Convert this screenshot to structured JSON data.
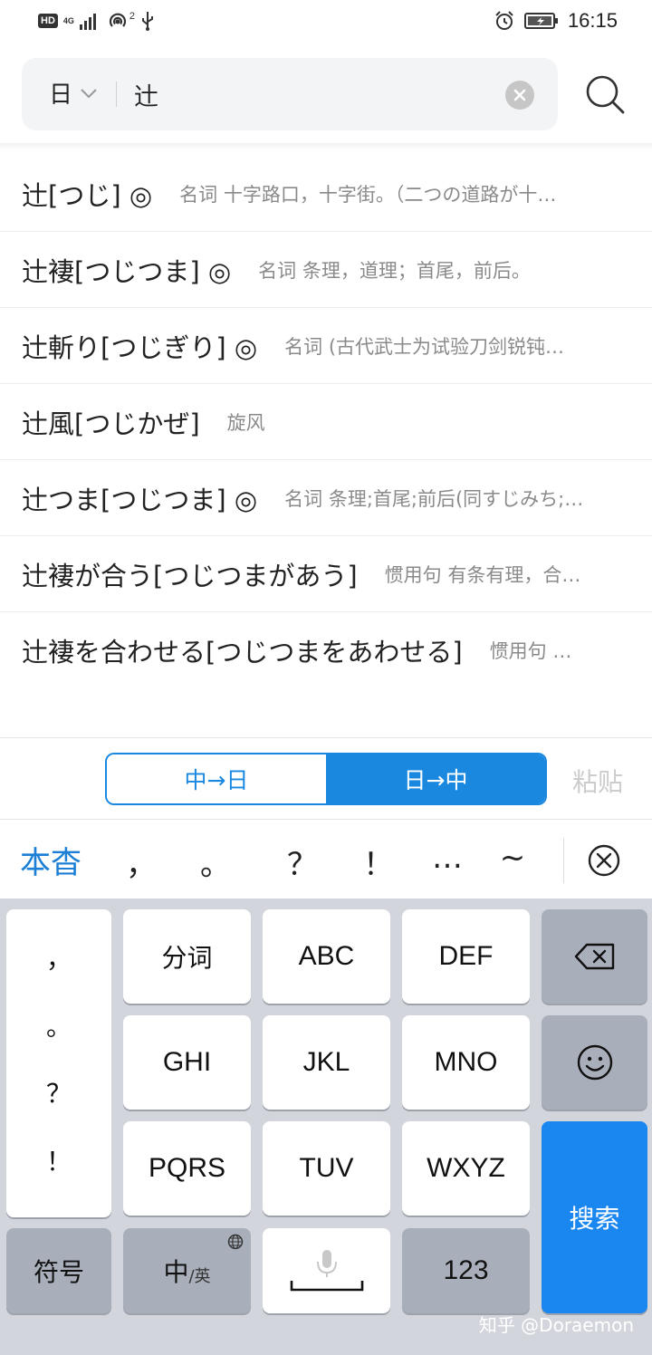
{
  "status_bar": {
    "hd": "HD",
    "network": "4G",
    "hotspot_count": "2",
    "time": "16:15"
  },
  "search": {
    "language": "日",
    "query": "辻"
  },
  "results": [
    {
      "word": "辻[つじ] ◎",
      "definition": "名词 十字路口，十字街。（二つの道路が十…"
    },
    {
      "word": "辻褄[つじつま] ◎",
      "definition": "名词 条理，道理；首尾，前后。"
    },
    {
      "word": "辻斬り[つじぎり] ◎",
      "definition": "名词 (古代武士为试验刀剑锐钝…"
    },
    {
      "word": "辻風[つじかぜ]",
      "definition": "旋风"
    },
    {
      "word": "辻つま[つじつま] ◎",
      "definition": "名词 条理;首尾;前后(同すじみち;…"
    },
    {
      "word": "辻褄が合う[つじつまがあう]",
      "definition": "惯用句 有条有理，合…"
    },
    {
      "word": "辻褄を合わせる[つじつまをあわせる]",
      "definition": "惯用句 …"
    }
  ],
  "direction": {
    "cn_to_jp": "中→日",
    "jp_to_cn": "日→中",
    "paste": "粘贴"
  },
  "candidates": {
    "main": "本杳",
    "punct": [
      "，",
      "。",
      "？",
      "！",
      "…",
      "~"
    ]
  },
  "keyboard": {
    "punct_column": [
      "，",
      "。",
      "？",
      "！"
    ],
    "row1": [
      "分词",
      "ABC",
      "DEF"
    ],
    "row2": [
      "GHI",
      "JKL",
      "MNO"
    ],
    "row3": [
      "PQRS",
      "TUV",
      "WXYZ"
    ],
    "symbol": "符号",
    "lang_main": "中",
    "lang_sub": "/英",
    "num": "123",
    "search": "搜索"
  },
  "watermark": "知乎 @Doraemon",
  "colors": {
    "accent": "#1b88e0",
    "search_key": "#1a86f0",
    "keyboard_bg": "#d2d5db",
    "gray_key": "#a9afba"
  },
  "icons": {
    "hd": "hd-badge-icon",
    "signal": "signal-icon",
    "hotspot": "hotspot-icon",
    "usb": "usb-icon",
    "alarm": "alarm-icon",
    "battery": "battery-icon",
    "clear": "clear-icon",
    "search": "search-icon",
    "close": "close-circle-icon",
    "backspace": "backspace-icon",
    "emoji": "emoji-icon",
    "mic": "mic-icon",
    "globe": "globe-icon"
  }
}
